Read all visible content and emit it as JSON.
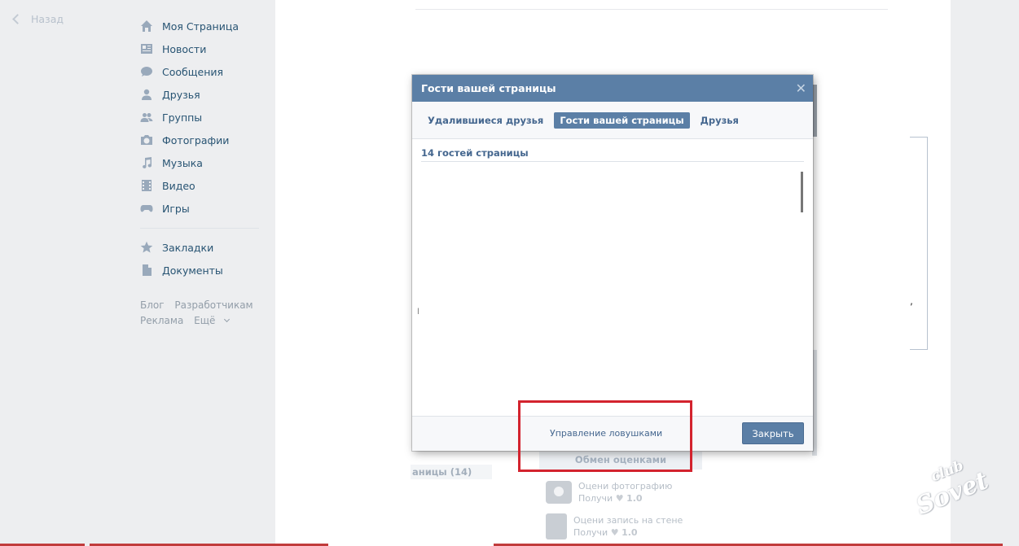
{
  "back": {
    "label": "Назад"
  },
  "menu": {
    "items": [
      {
        "label": "Моя Страница",
        "icon": "home-icon"
      },
      {
        "label": "Новости",
        "icon": "news-icon"
      },
      {
        "label": "Сообщения",
        "icon": "messages-icon"
      },
      {
        "label": "Друзья",
        "icon": "friends-icon"
      },
      {
        "label": "Группы",
        "icon": "groups-icon"
      },
      {
        "label": "Фотографии",
        "icon": "camera-icon"
      },
      {
        "label": "Музыка",
        "icon": "music-icon"
      },
      {
        "label": "Видео",
        "icon": "video-icon"
      },
      {
        "label": "Игры",
        "icon": "gamepad-icon"
      }
    ],
    "extra": [
      {
        "label": "Закладки",
        "icon": "star-icon"
      },
      {
        "label": "Документы",
        "icon": "document-icon"
      }
    ]
  },
  "footer_links": {
    "blog": "Блог",
    "developers": "Разработчикам",
    "ads": "Реклама",
    "more": "Ещё"
  },
  "modal": {
    "title": "Гости вашей страницы",
    "close_glyph": "✕",
    "tabs": [
      {
        "label": "Удалившиеся друзья",
        "active": false
      },
      {
        "label": "Гости вашей страницы",
        "active": true
      },
      {
        "label": "Друзья",
        "active": false
      }
    ],
    "count_text": "14 гостей страницы",
    "stray_glyph": "l",
    "manage_traps": "Управление ловушками",
    "close_button": "Закрыть"
  },
  "background": {
    "label": "аницы (14)",
    "exchange": "Обмен оценками",
    "rate_photo": {
      "title": "Оцени фотографию",
      "get": "Получи",
      "value": "1.0"
    },
    "rate_post": {
      "title": "Оцени запись на стене",
      "get": "Получи",
      "value": "1.0"
    },
    "comma": ","
  },
  "watermark": {
    "top": "club",
    "bottom": "Sovet"
  },
  "colors": {
    "accent": "#5b7fa6",
    "highlight": "#d3232e",
    "background": "#edeef0"
  }
}
